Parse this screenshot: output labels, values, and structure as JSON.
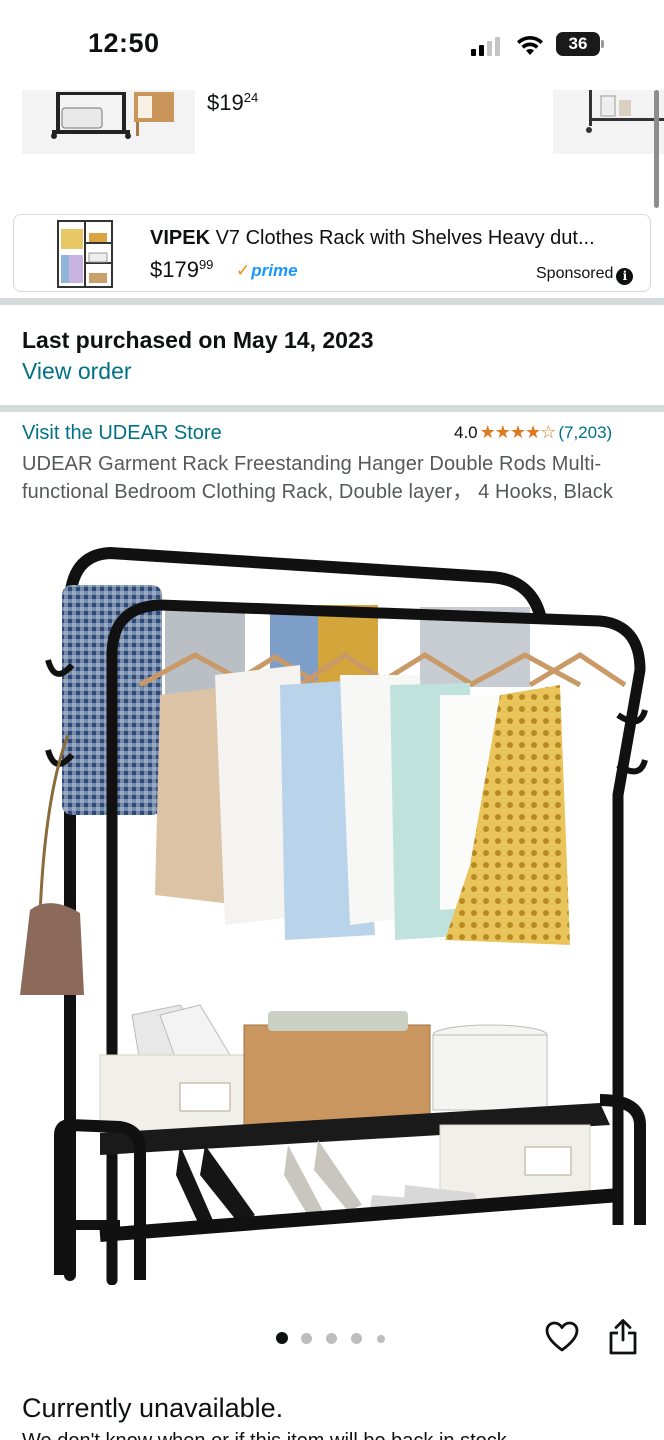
{
  "status_bar": {
    "time": "12:50",
    "battery": "36"
  },
  "carousel": {
    "price_dollars": "$19",
    "price_cents": "24"
  },
  "sponsored_ad": {
    "brand": "VIPEK",
    "title": " V7 Clothes Rack with Shelves Heavy dut...",
    "price_dollars": "$179",
    "price_cents": "99",
    "prime_label": "prime",
    "sponsored_label": "Sponsored",
    "info_icon": "i"
  },
  "purchase": {
    "last_purchased": "Last purchased on May 14, 2023",
    "view_order": "View order"
  },
  "product": {
    "store_link": "Visit the UDEAR Store",
    "rating": "4.0",
    "stars": "★★★★☆",
    "rating_count": "(7,203)",
    "title": "UDEAR Garment Rack Freestanding Hanger Double Rods Multi-functional Bedroom Clothing Rack, Double layer， 4 Hooks, Black",
    "image_count": 5,
    "active_image": 1
  },
  "availability": {
    "status": "Currently unavailable.",
    "detail": "We don't know when or if this item will be back in stock."
  },
  "colors": {
    "link": "#007185",
    "star": "#de7921",
    "prime": "#1a98ff",
    "divider": "#d5dbdb"
  }
}
